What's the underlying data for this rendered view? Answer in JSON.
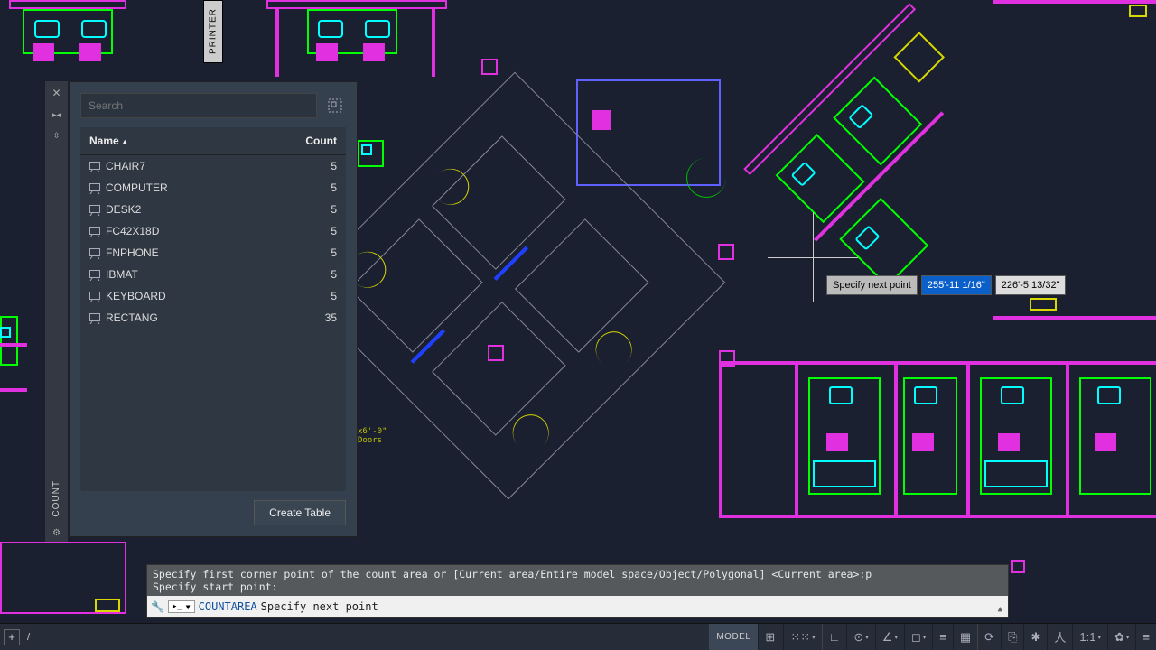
{
  "sidebar": {
    "label": "COUNT"
  },
  "printer_label": "PRINTER",
  "palette": {
    "search_placeholder": "Search",
    "columns": {
      "name": "Name",
      "count": "Count"
    },
    "rows": [
      {
        "name": "CHAIR7",
        "count": 5
      },
      {
        "name": "COMPUTER",
        "count": 5
      },
      {
        "name": "DESK2",
        "count": 5
      },
      {
        "name": "FC42X18D",
        "count": 5
      },
      {
        "name": "FNPHONE",
        "count": 5
      },
      {
        "name": "IBMAT",
        "count": 5
      },
      {
        "name": "KEYBOARD",
        "count": 5
      },
      {
        "name": "RECTANG",
        "count": 35
      }
    ],
    "create_table": "Create Table"
  },
  "dynamic_input": {
    "prompt": "Specify next point",
    "coord1": "255'-11 1/16\"",
    "coord2": "226'-5 13/32\""
  },
  "command": {
    "history_line1": "Specify first corner point of the count area or [Current area/Entire model space/Object/Polygonal] <Current area>:p",
    "history_line2": "Specify start point:",
    "active_command": "COUNTAREA",
    "prompt_suffix": "Specify next point"
  },
  "annotation": {
    "text1": "x6'-0\"",
    "text2": "Doors"
  },
  "statusbar": {
    "model": "MODEL",
    "scale": "1:1",
    "slash": "/"
  }
}
